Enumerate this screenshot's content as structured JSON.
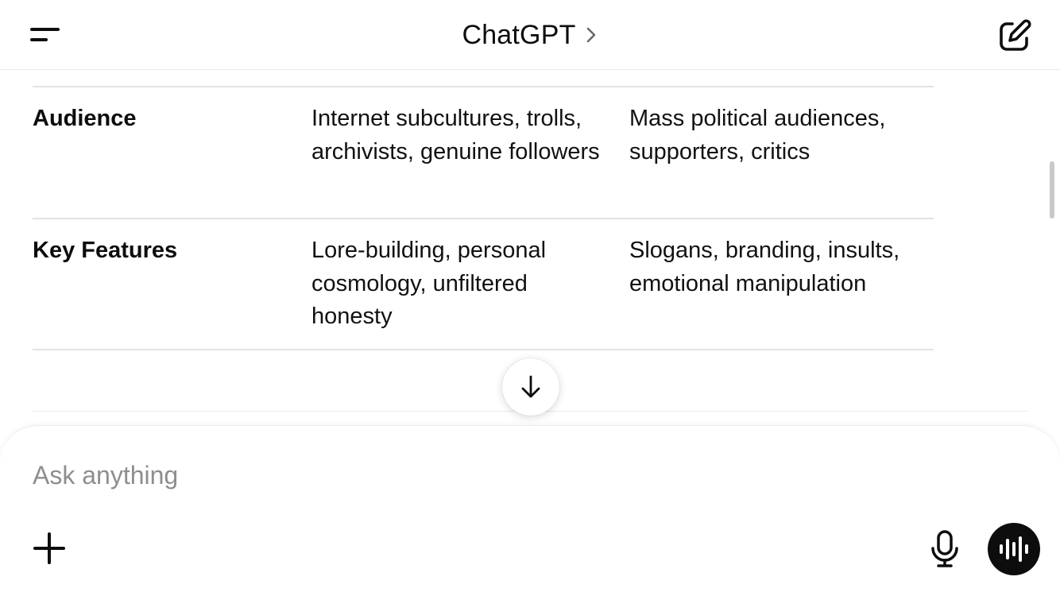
{
  "header": {
    "menu_icon": "menu-icon",
    "title": "ChatGPT",
    "title_chevron_icon": "chevron-right-icon",
    "new_chat_icon": "compose-icon"
  },
  "table": {
    "rows": [
      {
        "label": "Audience",
        "col2": "Internet subcultures, trolls, archivists, genuine followers",
        "col3": "Mass political audiences, supporters, critics"
      },
      {
        "label": "Key Features",
        "col2": "Lore-building, personal cosmology, unfiltered honesty",
        "col3": "Slogans, branding, insults, emotional manipulation"
      }
    ]
  },
  "scroll_down_icon": "arrow-down-icon",
  "composer": {
    "placeholder": "Ask anything",
    "value": "",
    "plus_icon": "plus-icon",
    "mic_icon": "microphone-icon",
    "voice_icon": "voice-waveform-icon"
  },
  "colors": {
    "text": "#0d0d0d",
    "divider": "#e3e3e3",
    "placeholder": "#8e8e8e",
    "voice_button": "#0d0d0d"
  }
}
